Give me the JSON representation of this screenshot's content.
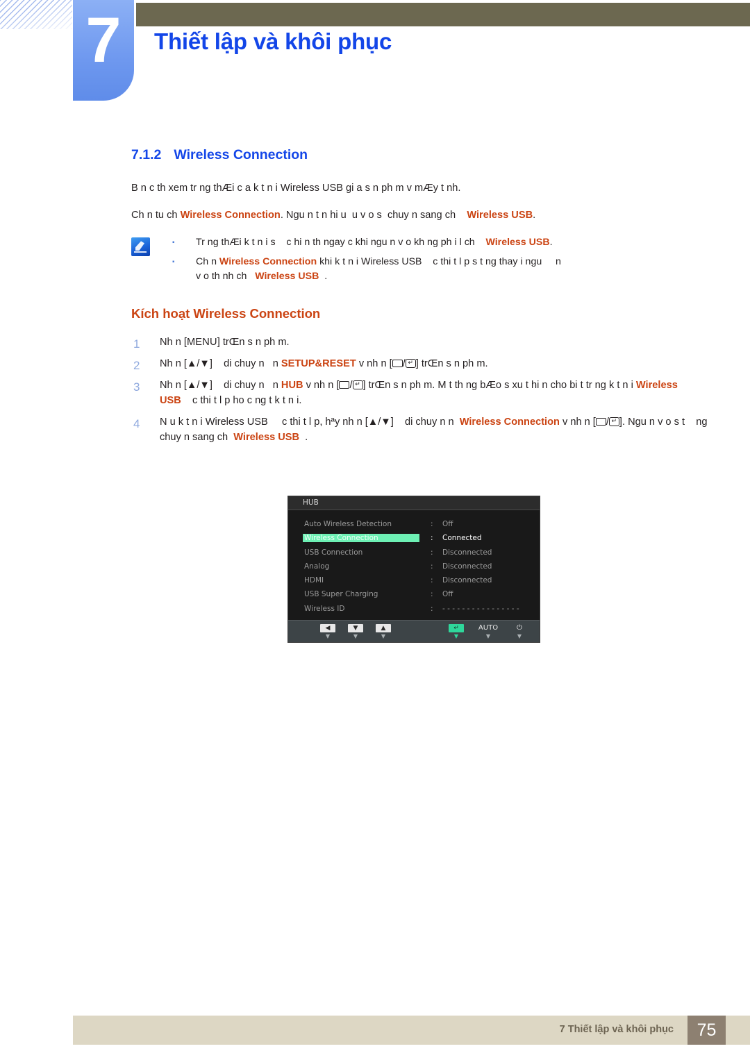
{
  "header": {
    "chapter_number": "7",
    "chapter_title": "Thiết lập và khôi phục",
    "accent_blue": "#1346e8",
    "badge_blue": "#6e98ef",
    "olive": "#6c6850"
  },
  "section": {
    "number": "7.1.2",
    "title": "Wireless Connection"
  },
  "paragraphs": {
    "p1": "B n c th  xem tr ng thÆi c a k t n i Wireless USB gi a s n ph m v  mÆy t nh.",
    "p2_a": "Ch n tu ch",
    "p2_kw1": "Wireless Connection",
    "p2_b": ". Ngu n t n hi u",
    "p2_c": "u v o s",
    "p2_d": "chuy n sang ch",
    "p2_kw2": "Wireless USB",
    "p2_e": "."
  },
  "note": {
    "icon": "note-pencil-icon",
    "items": [
      {
        "bullet": "▪",
        "a": "Tr ng thÆi k t n i s",
        "b": "c hi n th  ngay c  khi ngu n v o kh ng ph i l  ch",
        "kw": "Wireless USB",
        "c": "."
      },
      {
        "bullet": "▪",
        "a": "Ch n",
        "kw1": "Wireless Connection",
        "b": "khi k t n i Wireless USB",
        "c": "c thi t l p s  t  ng thay i ngu",
        "d": "n",
        "e": "v o th nh ch",
        "kw2": "Wireless USB",
        "f": "."
      }
    ]
  },
  "sub_heading": "Kích hoạt Wireless Connection",
  "steps": [
    {
      "num": "1",
      "parts": [
        {
          "t": "Nh n ["
        },
        {
          "t": "MENU",
          "style": "keycap"
        },
        {
          "t": "] trŒn s n ph m."
        }
      ]
    },
    {
      "num": "2",
      "parts": [
        {
          "t": "Nh n [▲/▼]"
        },
        {
          "t": "di chuy n"
        },
        {
          "t": "n"
        },
        {
          "t": "SETUP&RESET",
          "style": "kw"
        },
        {
          "t": "v  nh n ["
        },
        {
          "t": "BOX",
          "style": "glyph-box"
        },
        {
          "t": "/"
        },
        {
          "t": "ENTER",
          "style": "glyph-enter"
        },
        {
          "t": "] trŒn s n ph m."
        }
      ]
    },
    {
      "num": "3",
      "parts": [
        {
          "t": "Nh n [▲/▼]"
        },
        {
          "t": "di chuy n"
        },
        {
          "t": "n"
        },
        {
          "t": "HUB",
          "style": "kw"
        },
        {
          "t": "v  nh n ["
        },
        {
          "t": "BOX",
          "style": "glyph-box"
        },
        {
          "t": "/"
        },
        {
          "t": "ENTER",
          "style": "glyph-enter"
        },
        {
          "t": "] trŒn s n ph m. M t th ng bÆo s  xu t hi n cho bi t tr ng k t n i"
        },
        {
          "t": "Wireless USB",
          "style": "kw"
        },
        {
          "t": "c thi t l p ho c ng t k t n i."
        }
      ]
    },
    {
      "num": "4",
      "parts": [
        {
          "t": "N u k t n i Wireless USB"
        },
        {
          "t": "c thi t l p, hªy nh n [▲/▼]"
        },
        {
          "t": "di chuy n n"
        },
        {
          "t": "Wireless Connection",
          "style": "kw"
        },
        {
          "t": "v  nh n ["
        },
        {
          "t": "BOX",
          "style": "glyph-box"
        },
        {
          "t": "/"
        },
        {
          "t": "ENTER",
          "style": "glyph-enter"
        },
        {
          "t": "]. Ngu n v o s  t"
        },
        {
          "t": "ng chuy n sang ch"
        },
        {
          "t": "Wireless USB",
          "style": "kw"
        },
        {
          "t": "."
        }
      ]
    }
  ],
  "osd": {
    "title": "HUB",
    "separator": ":",
    "highlight_color": "#6df0b4",
    "rows": [
      {
        "label": "Auto Wireless Detection",
        "value": "Off",
        "selected": false
      },
      {
        "label": "Wireless Connection",
        "value": "Connected",
        "selected": true
      },
      {
        "label": "USB Connection",
        "value": "Disconnected",
        "selected": false
      },
      {
        "label": "Analog",
        "value": "Disconnected",
        "selected": false
      },
      {
        "label": "HDMI",
        "value": "Disconnected",
        "selected": false
      },
      {
        "label": "USB Super Charging",
        "value": "Off",
        "selected": false
      },
      {
        "label": "Wireless ID",
        "value": "- - - - - - - - - - - - - - - -",
        "selected": false
      }
    ],
    "buttons": [
      {
        "glyph": "◀",
        "name": "left-arrow",
        "tick": "▼",
        "type": "key"
      },
      {
        "glyph": "▼",
        "name": "down-arrow",
        "tick": "▼",
        "type": "key"
      },
      {
        "glyph": "▲",
        "name": "up-arrow",
        "tick": "▼",
        "type": "key"
      },
      {
        "glyph": "↵",
        "name": "enter",
        "tick": "▼",
        "type": "key-green"
      },
      {
        "glyph": "AUTO",
        "name": "auto",
        "tick": "▼",
        "type": "text"
      },
      {
        "glyph": "⏻",
        "name": "power",
        "tick": "▼",
        "type": "text"
      }
    ]
  },
  "footer": {
    "text": "7 Thiết lập và khôi phục",
    "page": "75",
    "bar_color": "#ddd7c4",
    "page_box_color": "#8d8071"
  }
}
